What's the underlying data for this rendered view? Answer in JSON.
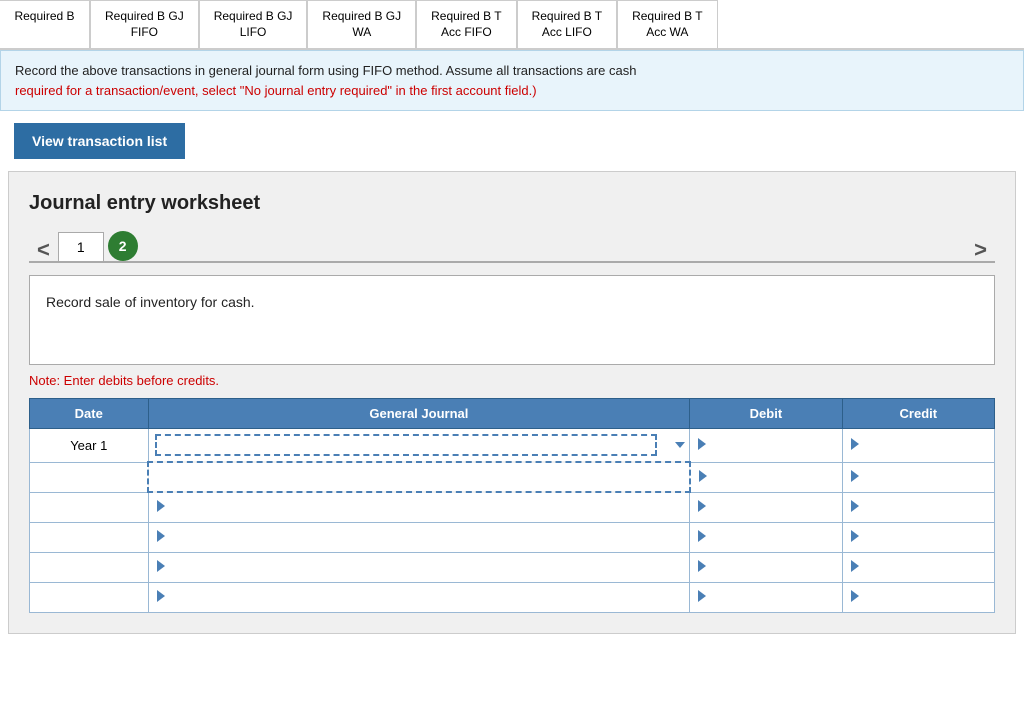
{
  "tabs": [
    {
      "id": "required-b",
      "label": "Required B",
      "line2": ""
    },
    {
      "id": "required-b-gj-fifo",
      "label": "Required B GJ",
      "line2": "FIFO"
    },
    {
      "id": "required-b-gj-lifo",
      "label": "Required B GJ",
      "line2": "LIFO"
    },
    {
      "id": "required-b-gj-wa",
      "label": "Required B GJ",
      "line2": "WA"
    },
    {
      "id": "required-b-t-fifo",
      "label": "Required B T",
      "line2": "Acc FIFO"
    },
    {
      "id": "required-b-t-lifo",
      "label": "Required B T",
      "line2": "Acc LIFO"
    },
    {
      "id": "required-b-t-wa",
      "label": "Required B T",
      "line2": "Acc WA"
    }
  ],
  "info_box": {
    "black_text": "Record the above transactions in general journal form using FIFO method. Assume all transactions are cash",
    "red_text": "required for a transaction/event, select \"No journal entry required\" in the first account field.)"
  },
  "view_button": "View transaction list",
  "worksheet": {
    "title": "Journal entry worksheet",
    "left_arrow": "<",
    "right_arrow": ">",
    "page1_label": "1",
    "page2_label": "2",
    "description": "Record sale of inventory for cash.",
    "note": "Note: Enter debits before credits.",
    "table": {
      "headers": [
        "Date",
        "General Journal",
        "Debit",
        "Credit"
      ],
      "rows": [
        {
          "date": "Year 1",
          "gj": "",
          "debit": "",
          "credit": "",
          "has_dropdown": true,
          "dashed": true
        },
        {
          "date": "",
          "gj": "",
          "debit": "",
          "credit": "",
          "has_dropdown": false,
          "dashed": false
        },
        {
          "date": "",
          "gj": "",
          "debit": "",
          "credit": "",
          "has_dropdown": false,
          "dashed": false
        },
        {
          "date": "",
          "gj": "",
          "debit": "",
          "credit": "",
          "has_dropdown": false,
          "dashed": false
        },
        {
          "date": "",
          "gj": "",
          "debit": "",
          "credit": "",
          "has_dropdown": false,
          "dashed": false
        },
        {
          "date": "",
          "gj": "",
          "debit": "",
          "credit": "",
          "has_dropdown": false,
          "dashed": false
        }
      ]
    }
  }
}
